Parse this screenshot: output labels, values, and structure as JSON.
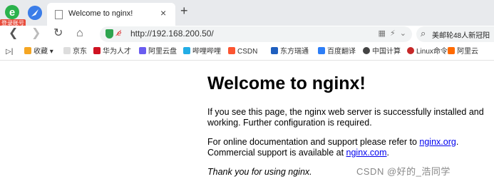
{
  "browser": {
    "login_badge": "登录账号",
    "tab_title": "Welcome to nginx!",
    "tab_close": "×",
    "new_tab": "+",
    "url": "http://192.168.200.50/",
    "search_query": "美邮轮48人新冠阳"
  },
  "bookmarks": [
    {
      "label": "收藏",
      "color": "#f5a623"
    },
    {
      "label": "京东",
      "color": "#bbbbbb"
    },
    {
      "label": "华为人才",
      "color": "#cf1322"
    },
    {
      "label": "阿里云盘",
      "color": "#6a5cf0"
    },
    {
      "label": "哔哩哔哩",
      "color": "#23ade5"
    },
    {
      "label": "CSDN",
      "color": "#fc5531"
    },
    {
      "label": "东方瑞通",
      "color": "#1f5fbf"
    },
    {
      "label": "百度翻译",
      "color": "#2d7ef7"
    },
    {
      "label": "中国计算",
      "color": "#444444"
    },
    {
      "label": "Linux命令",
      "color": "#c62828"
    },
    {
      "label": "阿里云",
      "color": "#ff6a00"
    }
  ],
  "page": {
    "heading": "Welcome to nginx!",
    "para1": "If you see this page, the nginx web server is successfully installed and working. Further configuration is required.",
    "para2_prefix": "For online documentation and support please refer to ",
    "link1": "nginx.org",
    "para2_mid": ".",
    "para2_line2_prefix": "Commercial support is available at ",
    "link2": "nginx.com",
    "para2_end": ".",
    "thanks": "Thank you for using nginx."
  },
  "watermark": "CSDN @好的_浩同学"
}
